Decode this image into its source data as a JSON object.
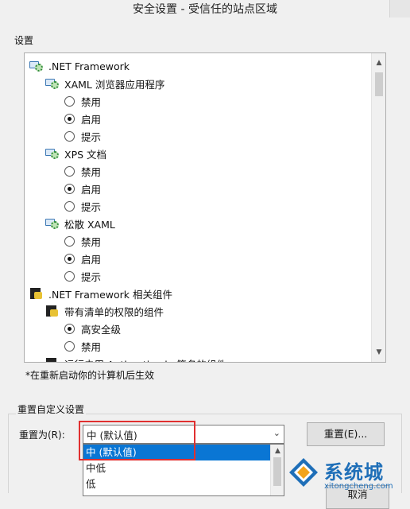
{
  "window": {
    "title": "安全设置 - 受信任的站点区域"
  },
  "settings": {
    "group_label": "设置",
    "tree": [
      {
        "type": "category",
        "icon": "gear-globe-icon",
        "label": ".NET Framework",
        "indent": 0
      },
      {
        "type": "category",
        "icon": "gear-globe-icon",
        "label": "XAML 浏览器应用程序",
        "indent": 1
      },
      {
        "type": "option",
        "label": "禁用",
        "checked": false,
        "indent": 2
      },
      {
        "type": "option",
        "label": "启用",
        "checked": true,
        "indent": 2
      },
      {
        "type": "option",
        "label": "提示",
        "checked": false,
        "indent": 2
      },
      {
        "type": "category",
        "icon": "gear-globe-icon",
        "label": "XPS 文档",
        "indent": 1
      },
      {
        "type": "option",
        "label": "禁用",
        "checked": false,
        "indent": 2
      },
      {
        "type": "option",
        "label": "启用",
        "checked": true,
        "indent": 2
      },
      {
        "type": "option",
        "label": "提示",
        "checked": false,
        "indent": 2
      },
      {
        "type": "category",
        "icon": "gear-globe-icon",
        "label": "松散 XAML",
        "indent": 1
      },
      {
        "type": "option",
        "label": "禁用",
        "checked": false,
        "indent": 2
      },
      {
        "type": "option",
        "label": "启用",
        "checked": true,
        "indent": 2
      },
      {
        "type": "option",
        "label": "提示",
        "checked": false,
        "indent": 2
      },
      {
        "type": "category",
        "icon": "certificate-icon",
        "label": ".NET Framework 相关组件",
        "indent": 0
      },
      {
        "type": "category",
        "icon": "certificate-icon",
        "label": "带有清单的权限的组件",
        "indent": 1
      },
      {
        "type": "option",
        "label": "高安全级",
        "checked": true,
        "indent": 2
      },
      {
        "type": "option",
        "label": "禁用",
        "checked": false,
        "indent": 2
      },
      {
        "type": "category",
        "icon": "certificate-icon",
        "label": "运行未用 Authenticode 签名的组件",
        "indent": 1
      }
    ],
    "restart_note": "*在重新启动你的计算机后生效"
  },
  "reset": {
    "group_label": "重置自定义设置",
    "reset_to_label": "重置为(R):",
    "selected_value": "中 (默认值)",
    "options": [
      "中 (默认值)",
      "中低",
      "低"
    ],
    "highlighted_option": "中 (默认值)",
    "reset_button": "重置(E)..."
  },
  "footer": {
    "cancel_button": "取消"
  },
  "watermark": {
    "brand": "系统城",
    "url": "xitongcheng.com"
  },
  "colors": {
    "selection": "#0a76d4",
    "highlight_box": "#e03030",
    "watermark": "#1f6fb8"
  }
}
